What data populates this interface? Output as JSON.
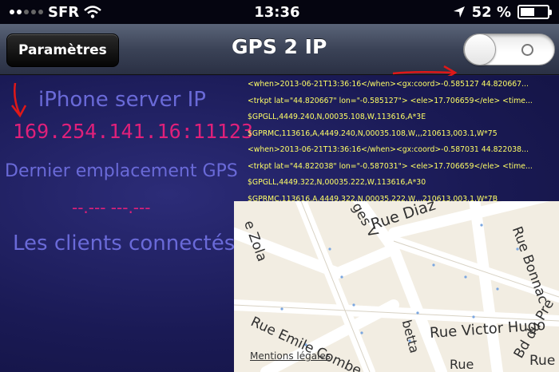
{
  "status_bar": {
    "carrier": "SFR",
    "time": "13:36",
    "battery": "52 %",
    "battery_level": 0.52
  },
  "nav": {
    "back_label": "Paramètres",
    "title": "GPS 2 IP",
    "toggle_on": false
  },
  "server": {
    "label": "iPhone server IP",
    "ip": "169.254.141.16:11123"
  },
  "gps": {
    "label": "Dernier emplacement GPS",
    "value": "--.--- ---.---"
  },
  "clients": {
    "label": "Les clients connectés"
  },
  "log": [
    "<when>2013-06-21T13:36:16</when><gx:coord>-0.585127 44.820667...",
    "<trkpt lat=\"44.820667\" lon=\"-0.585127\">   <ele>17.706659</ele>   <time...",
    "$GPGLL,4449.240,N,00035.108,W,113616,A*3E",
    "$GPRMC,113616,A,4449.240,N,00035.108,W,,,210613,003.1,W*75",
    "<when>2013-06-21T13:36:16</when><gx:coord>-0.587031 44.822038...",
    "<trkpt lat=\"44.822038\" lon=\"-0.587031\">   <ele>17.706659</ele>   <time...",
    "$GPGLL,4449.322,N,00035.222,W,113616,A*30",
    "$GPRMC,113616,A,4449.322,N,00035.222,W,,,210613,003.1,W*7B"
  ],
  "map": {
    "legal": "Mentions légales",
    "streets": [
      "Rue Diaz",
      "ges V",
      "e Zola",
      "Rue Victor Hugo",
      "Bd du Pre",
      "Rue Emile Combe",
      "Rue Bonnac",
      "Rue E",
      "betta",
      "Rue"
    ]
  },
  "colors": {
    "label": "#6a6ad8",
    "value": "#e0207a",
    "log": "#ffff66",
    "annotation_arrow": "#e01818"
  }
}
